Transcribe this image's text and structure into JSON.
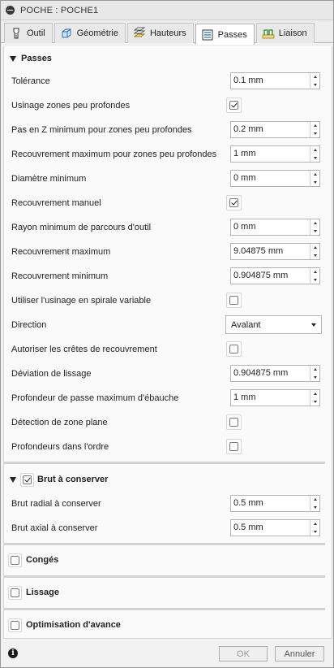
{
  "window": {
    "title": "POCHE : POCHE1"
  },
  "tabs": [
    {
      "label": "Outil",
      "icon": "tool-icon"
    },
    {
      "label": "Géométrie",
      "icon": "geometry-icon"
    },
    {
      "label": "Hauteurs",
      "icon": "heights-icon"
    },
    {
      "label": "Passes",
      "icon": "passes-icon"
    },
    {
      "label": "Liaison",
      "icon": "linking-icon"
    }
  ],
  "active_tab": "Passes",
  "passes": {
    "title": "Passes",
    "tolerance": {
      "label": "Tolérance",
      "value": "0.1 mm"
    },
    "shallow": {
      "label": "Usinage zones peu profondes",
      "checked": true
    },
    "shallow_min_z": {
      "label": "Pas en Z minimum pour zones peu profondes",
      "value": "0.2 mm"
    },
    "shallow_max_overlap": {
      "label": "Recouvrement maximum pour zones peu profondes",
      "value": "1 mm"
    },
    "min_diameter": {
      "label": "Diamètre minimum",
      "value": "0 mm"
    },
    "manual_overlap": {
      "label": "Recouvrement manuel",
      "checked": true
    },
    "min_toolpath_radius": {
      "label": "Rayon minimum de parcours d'outil",
      "value": "0 mm"
    },
    "max_overlap": {
      "label": "Recouvrement maximum",
      "value": "9.04875 mm"
    },
    "min_overlap": {
      "label": "Recouvrement minimum",
      "value": "0.904875 mm"
    },
    "variable_spiral": {
      "label": "Utiliser l'usinage en spirale variable",
      "checked": false
    },
    "direction": {
      "label": "Direction",
      "value": "Avalant"
    },
    "overlap_ridges": {
      "label": "Autoriser les crêtes de recouvrement",
      "checked": false
    },
    "smoothing_deviation": {
      "label": "Déviation de lissage",
      "value": "0.904875 mm"
    },
    "max_roughing_depth": {
      "label": "Profondeur de passe maximum d'ébauche",
      "value": "1 mm"
    },
    "flat_detection": {
      "label": "Détection de zone plane",
      "checked": false
    },
    "depths_in_order": {
      "label": "Profondeurs dans l'ordre",
      "checked": false
    }
  },
  "stock": {
    "title": "Brut à conserver",
    "enabled": true,
    "radial": {
      "label": "Brut radial à conserver",
      "value": "0.5 mm"
    },
    "axial": {
      "label": "Brut axial à conserver",
      "value": "0.5 mm"
    }
  },
  "fillets": {
    "title": "Congés",
    "enabled": false
  },
  "smoothing": {
    "title": "Lissage",
    "enabled": false
  },
  "feed_opt": {
    "title": "Optimisation d'avance",
    "enabled": false
  },
  "footer": {
    "ok": "OK",
    "cancel": "Annuler",
    "info": "i"
  }
}
